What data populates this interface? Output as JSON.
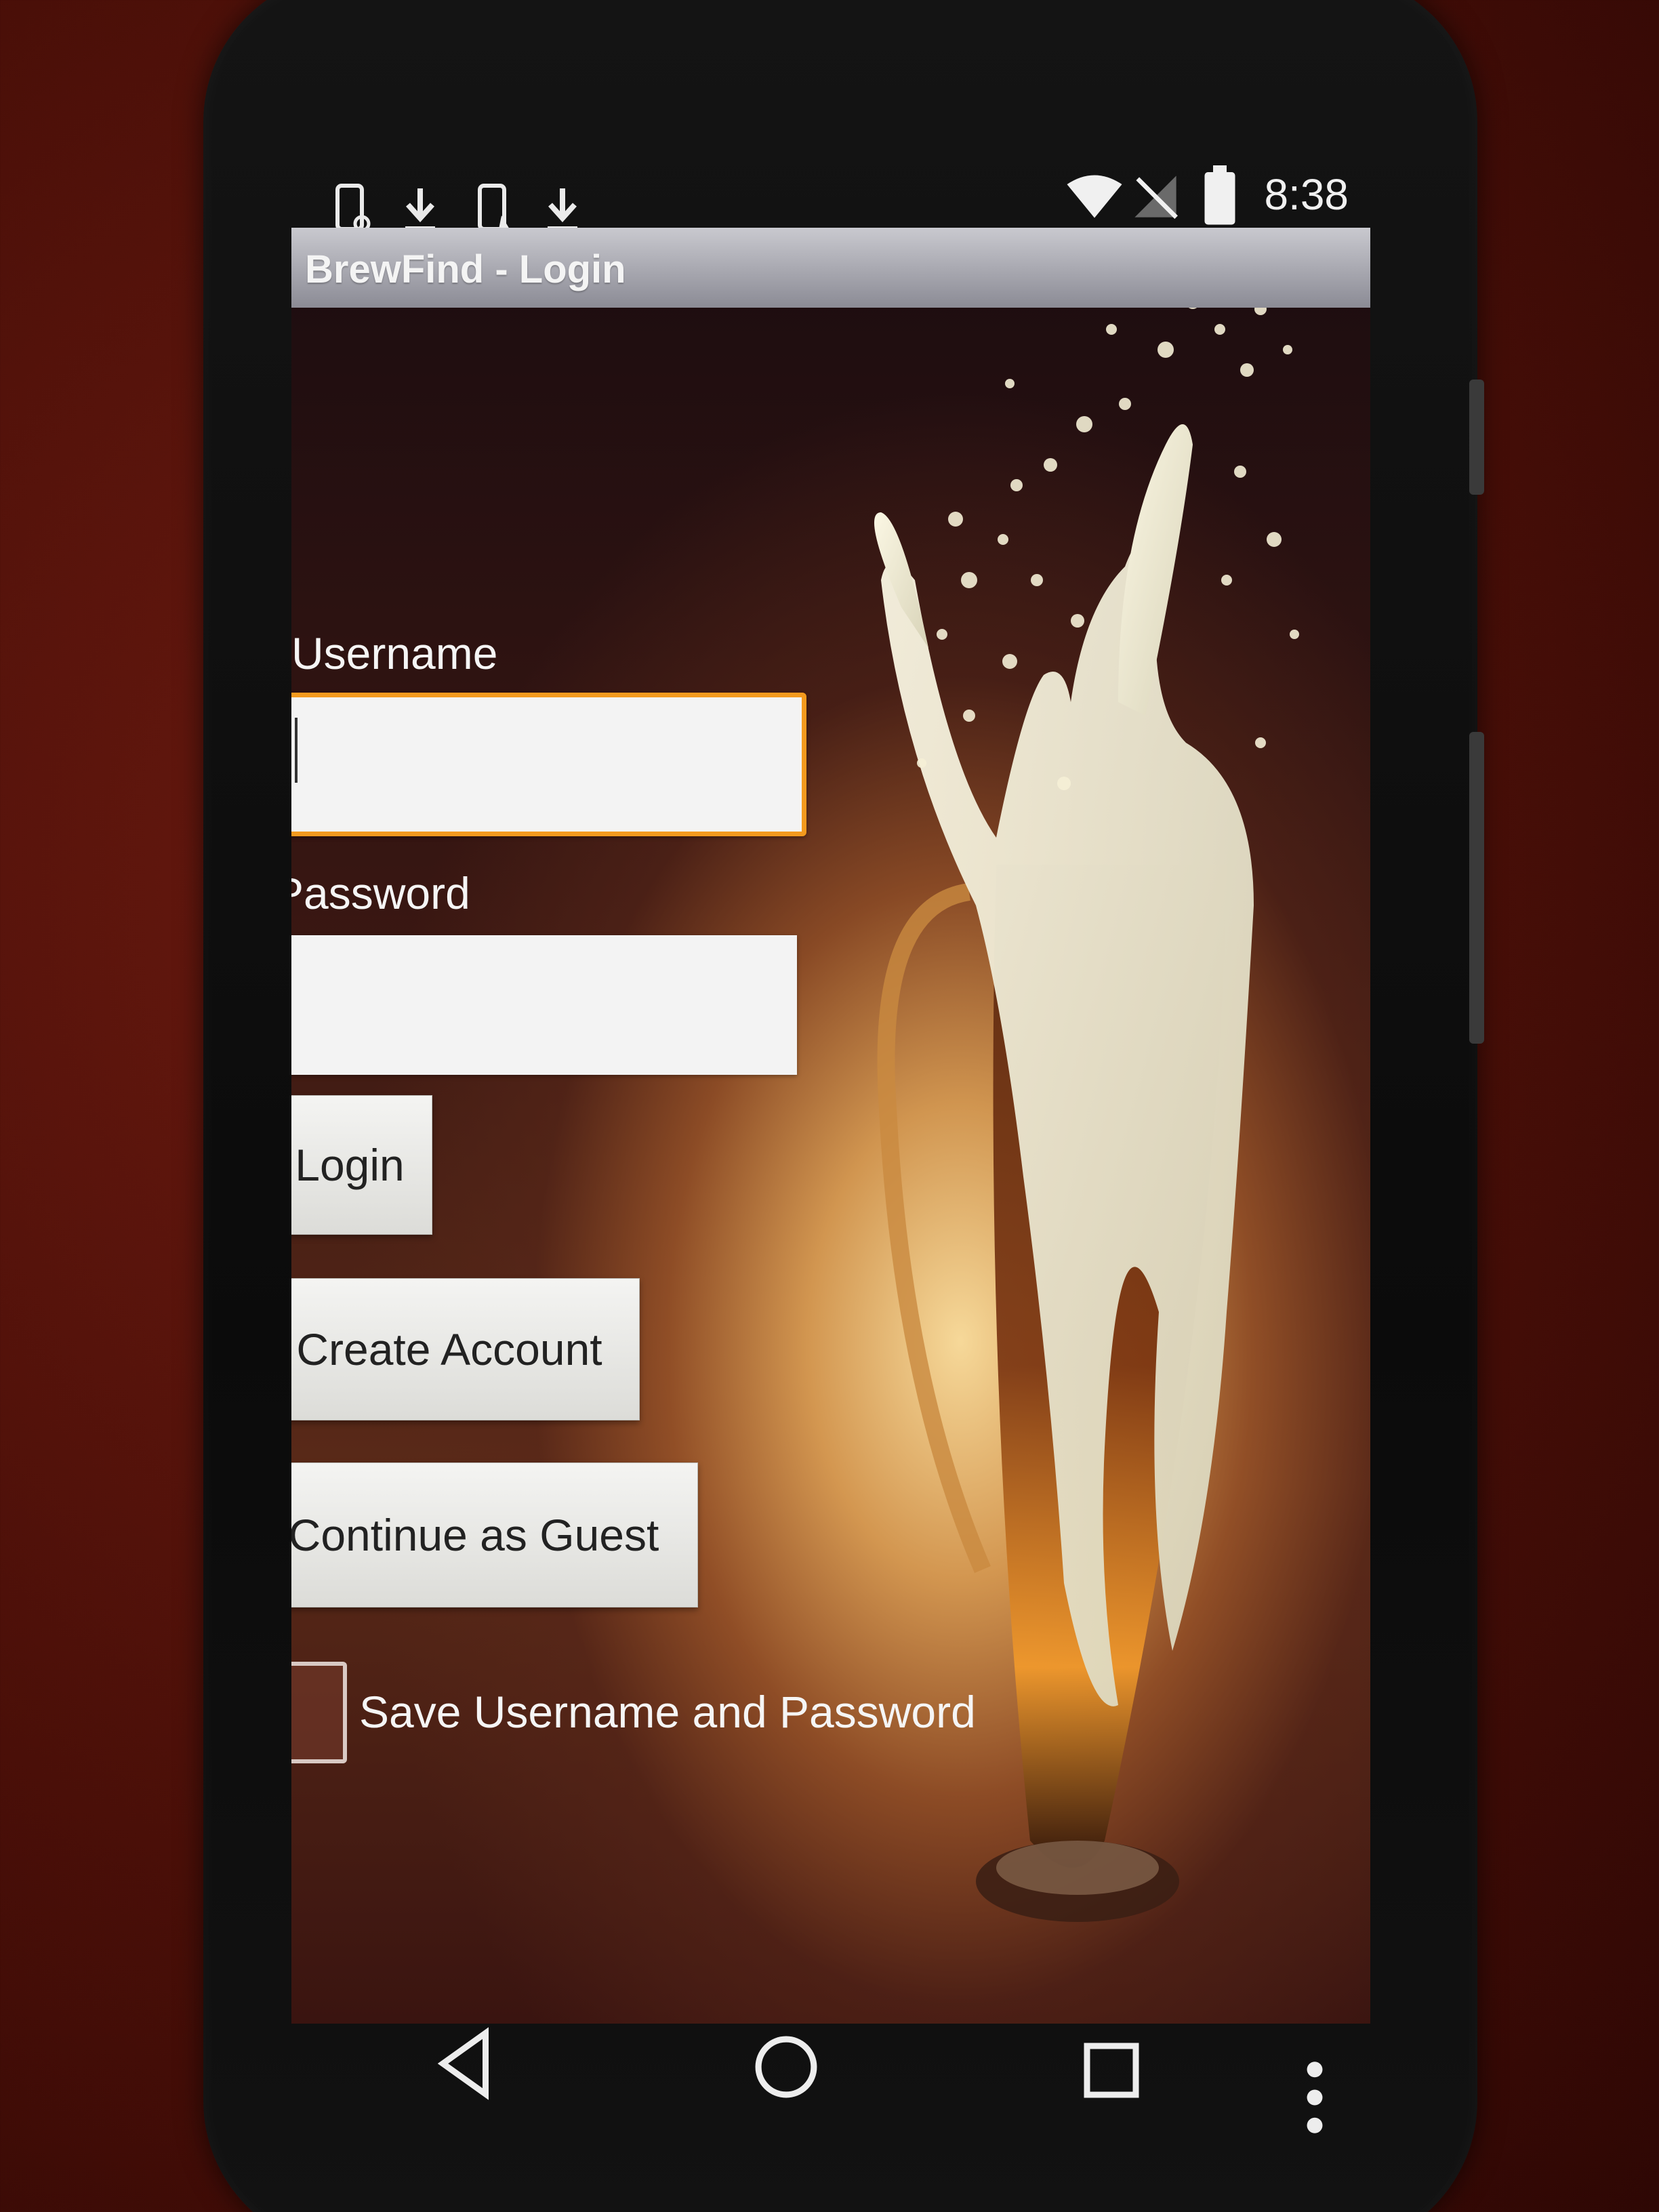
{
  "status_bar": {
    "time": "8:38",
    "left_icons": [
      "phone-icon",
      "download-icon",
      "phone-icon",
      "download-icon"
    ],
    "right_icons": [
      "wifi-icon",
      "no-signal-icon",
      "battery-icon"
    ]
  },
  "app": {
    "title": "BrewFind - Login"
  },
  "form": {
    "username_label": "Username",
    "username_value": "",
    "password_label": "Password",
    "password_value": "",
    "login_button": "Login",
    "create_account_button": "Create Account",
    "guest_button": "Continue as Guest",
    "save_checkbox_label": "Save Username and Password",
    "save_checked": false
  },
  "colors": {
    "focus_border": "#f39a1e",
    "title_bar": "#9a9aa3"
  },
  "nav_bar": {
    "icons": [
      "back-icon",
      "home-icon",
      "recents-icon",
      "overflow-menu-icon"
    ]
  }
}
